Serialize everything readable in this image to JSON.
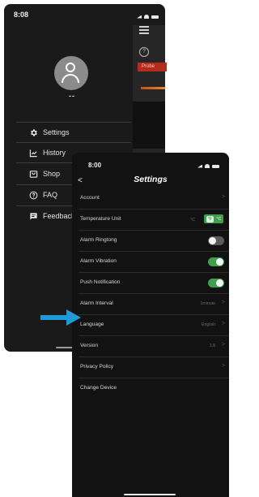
{
  "drawer_screen": {
    "status_time": "8:08",
    "username": "--",
    "overlay": {
      "probe_label": "Probe",
      "help_glyph": "?"
    },
    "menu": [
      {
        "label": "Settings",
        "icon": "gear-icon"
      },
      {
        "label": "History",
        "icon": "chart-icon"
      },
      {
        "label": "Shop",
        "icon": "shop-icon"
      },
      {
        "label": "FAQ",
        "icon": "help-circle-icon"
      },
      {
        "label": "Feedback",
        "icon": "message-icon"
      }
    ]
  },
  "settings_screen": {
    "status_time": "8:00",
    "back_glyph": "<",
    "title": "Settings",
    "rows": [
      {
        "label": "Account",
        "value": "",
        "control": "chevron"
      },
      {
        "label": "Temperature Unit",
        "value": "°C",
        "control": "unit-toggle"
      },
      {
        "label": "Alarm Ringtong",
        "value": "",
        "control": "toggle",
        "state": "off"
      },
      {
        "label": "Alarm Vibration",
        "value": "",
        "control": "toggle",
        "state": "on"
      },
      {
        "label": "Push Notification",
        "value": "",
        "control": "toggle",
        "state": "on"
      },
      {
        "label": "Alarm Interval",
        "value": "1minute",
        "control": "chevron"
      },
      {
        "label": "Language",
        "value": "English",
        "control": "chevron"
      },
      {
        "label": "Version",
        "value": "1.8",
        "control": "chevron"
      },
      {
        "label": "Privacy Policy",
        "value": "",
        "control": "chevron"
      },
      {
        "label": "Change Device",
        "value": "",
        "control": "none"
      }
    ],
    "unit_toggle": {
      "options": [
        "°F",
        "°C"
      ],
      "selected": "°F"
    },
    "chevron_glyph": ">"
  },
  "colors": {
    "accent_green": "#3f9f4f",
    "arrow_blue": "#1f9ad6",
    "probe_red": "#b52b1c"
  }
}
